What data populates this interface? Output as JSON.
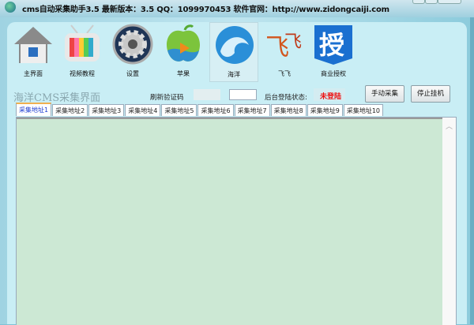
{
  "window": {
    "title": "cms自动采集助手3.5  最新版本：3.5  QQ：1099970453  软件官网：http://www.zidongcaiji.com"
  },
  "toolbar": {
    "items": [
      {
        "label": "主界面",
        "icon": "home-icon"
      },
      {
        "label": "视频教程",
        "icon": "tv-icon"
      },
      {
        "label": "设置",
        "icon": "gear-icon"
      },
      {
        "label": "苹果",
        "icon": "apple-icon"
      },
      {
        "label": "海洋",
        "icon": "ocean-icon"
      },
      {
        "label": "飞飞",
        "icon": "feifei-icon"
      },
      {
        "label": "商业授权",
        "icon": "license-icon"
      }
    ]
  },
  "main": {
    "panel_title": "海洋CMS采集界面",
    "refresh_captcha_label": "刷新验证码",
    "captcha_input": "",
    "login_status_label": "后台登陆状态:",
    "login_status": "未登陆",
    "manual_collect": "手动采集",
    "stop_hook": "停止挂机",
    "tabs": [
      "采集地址1",
      "采集地址2",
      "采集地址3",
      "采集地址4",
      "采集地址5",
      "采集地址6",
      "采集地址7",
      "采集地址8",
      "采集地址9",
      "采集地址10"
    ],
    "content": ""
  },
  "colors": {
    "status": "#e11111",
    "text_area": "#cce8d4"
  }
}
